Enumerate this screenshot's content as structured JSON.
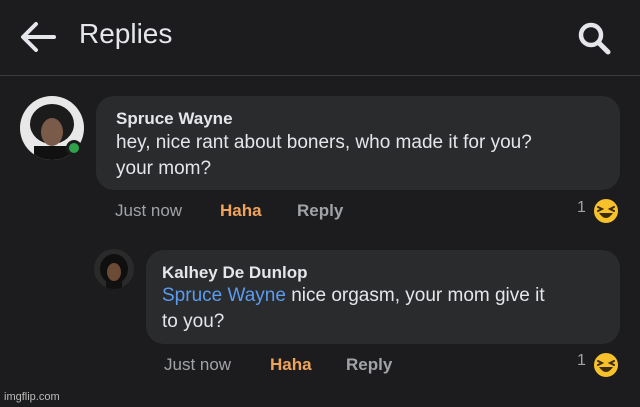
{
  "header": {
    "title": "Replies",
    "back_icon": "back-arrow-icon",
    "search_icon": "search-icon"
  },
  "comments": [
    {
      "author": "Spruce Wayne",
      "text_line1": "hey, nice rant about boners, who made it for you?",
      "text_line2": "your mom?",
      "time": "Just now",
      "reaction_label": "Haha",
      "reply_label": "Reply",
      "reaction_count": "1",
      "reaction_icon": "laughing-emoji-icon",
      "online": true
    },
    {
      "author": "Kalhey De Dunlop",
      "mention": "Spruce Wayne",
      "text_line1_rest": " nice orgasm, your mom give it",
      "text_line2": "to you?",
      "time": "Just now",
      "reaction_label": "Haha",
      "reply_label": "Reply",
      "reaction_count": "1",
      "reaction_icon": "laughing-emoji-icon"
    }
  ],
  "watermark": "imgflip.com",
  "colors": {
    "background": "#1c1c1e",
    "bubble": "#2a2b2d",
    "haha": "#f0a45b",
    "mention": "#5b9bf0",
    "online": "#31a24c"
  }
}
